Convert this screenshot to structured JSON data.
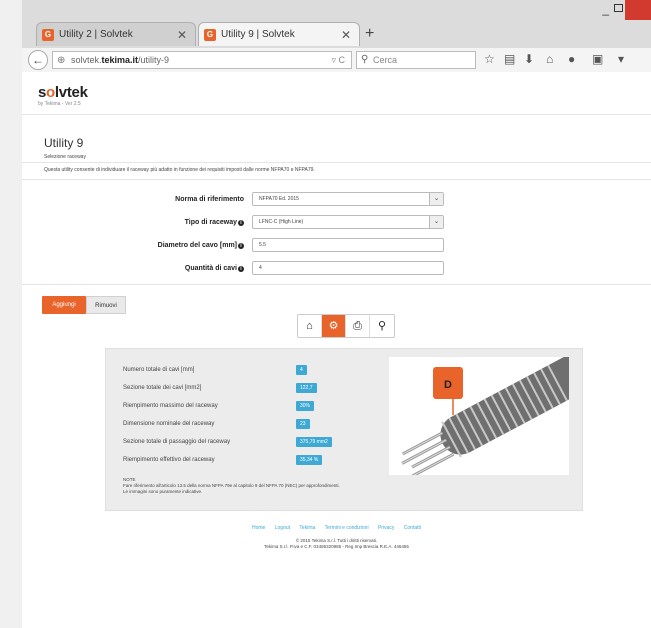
{
  "browser": {
    "tabs": [
      {
        "label": "Utility 2 | Solvtek",
        "favicon": "G"
      },
      {
        "label": "Utility 9 | Solvtek",
        "favicon": "G"
      }
    ],
    "url_prefix": "solvtek.",
    "url_domain": "tekima.it",
    "url_path": "/utility-9",
    "search_placeholder": "Cerca"
  },
  "header": {
    "logo_pre": "s",
    "logo_o": "o",
    "logo_post": "lvtek",
    "version": "by Tekima - Ver 2.5"
  },
  "main": {
    "title": "Utility 9",
    "subtitle": "Selezione raceway",
    "description": "Questa utility consente di individuare il raceway più adatto in funzione dei requisiti imposti dalle norme NFPA70 e NFPA79.",
    "form": {
      "norma_label": "Norma di riferimento",
      "norma_value": "NFPA70 Ed. 2015",
      "tipo_label": "Tipo di raceway",
      "tipo_value": "LFNC-C (High Line)",
      "diametro_label": "Diametro del cavo [mm]",
      "diametro_value": "5.5",
      "quantita_label": "Quantità di cavi",
      "quantita_value": "4"
    },
    "buttons": {
      "add": "Aggiungi",
      "remove": "Rimuovi"
    },
    "results": [
      {
        "label": "Numero totale di cavi [mm]",
        "value": "4"
      },
      {
        "label": "Sezione totale dei cavi [mm2]",
        "value": "122,7"
      },
      {
        "label": "Riempimento massimo del raceway",
        "value": "30%"
      },
      {
        "label": "Dimensione nominale del raceway",
        "value": "23"
      },
      {
        "label": "Sezione totale di passaggio del raceway",
        "value": "375,79 mm2"
      },
      {
        "label": "Riempimento effettivo del raceway",
        "value": "35,34 %"
      }
    ],
    "image_label": "D",
    "note_title": "NOTE",
    "note_line1": "Fare riferimento all'articolo 13.5 della norma NFPA 79e al capitolo 9 del NFPA 70 (NEC) per approfondimenti.",
    "note_line2": "Le immagini sono puramente indicative."
  },
  "footer": {
    "links": [
      "Home",
      "Logout",
      "Tekima",
      "Termini e condizioni",
      "Privacy",
      "Contatti"
    ],
    "copy1": "© 2015 Tekima S.r.l. Tutti i diritti riservati.",
    "copy2": "Tekima S.r.l. P.iva e C.F. 03485320985 - Reg Imp Brescia R.E.A. 446455"
  },
  "colors": {
    "accent": "#e8642a",
    "badge": "#3fa9d6"
  }
}
